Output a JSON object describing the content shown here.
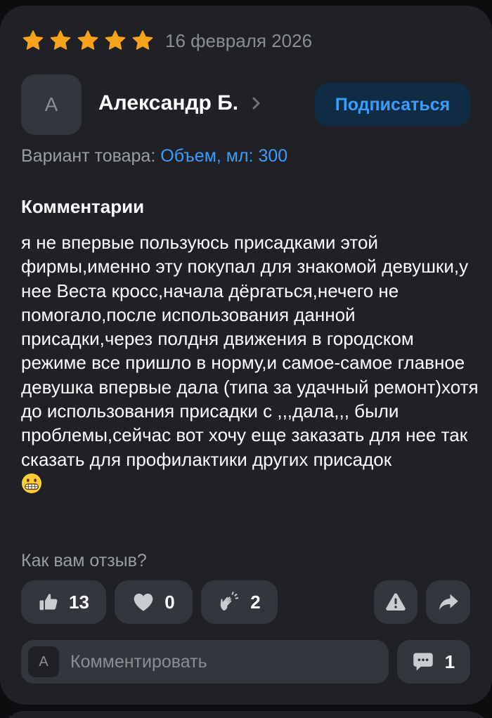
{
  "review": {
    "rating": 5,
    "rating_max": 5,
    "date": "16 февраля 2026",
    "author": {
      "initial": "А",
      "name": "Александр Б."
    },
    "subscribe_label": "Подписаться",
    "variant_label": "Вариант товара:",
    "variant_value": "Объем, мл: 300",
    "comments_title": "Комментарии",
    "text": "я не впервые пользуюсь присадками этой фирмы,именно эту покупал для знакомой девушки,у нее Веста кросс,начала дёргаться,нечего не помогало,после использования данной присадки,через полдня движения в городском режиме все пришло в норму,и самое-самое главное девушка впервые дала (типа за удачный ремонт)хотя до использования присадки с ,,,дала,,, были проблемы,сейчас вот хочу еще заказать для нее так сказать для профилактики других присадок",
    "text_emoji": "grinning-face-icon"
  },
  "feedback": {
    "question": "Как вам отзыв?",
    "likes": "13",
    "hearts": "0",
    "claps": "2"
  },
  "comment_bar": {
    "avatar_initial": "А",
    "placeholder": "Комментировать",
    "comments_count": "1"
  },
  "colors": {
    "background": "#0c0d0f",
    "card": "#1f2126",
    "button": "#33363c",
    "star": "#f6a31b",
    "accent": "#3a9dfb",
    "subscribe_bg": "#102c45",
    "muted_text": "#9a9da3"
  }
}
